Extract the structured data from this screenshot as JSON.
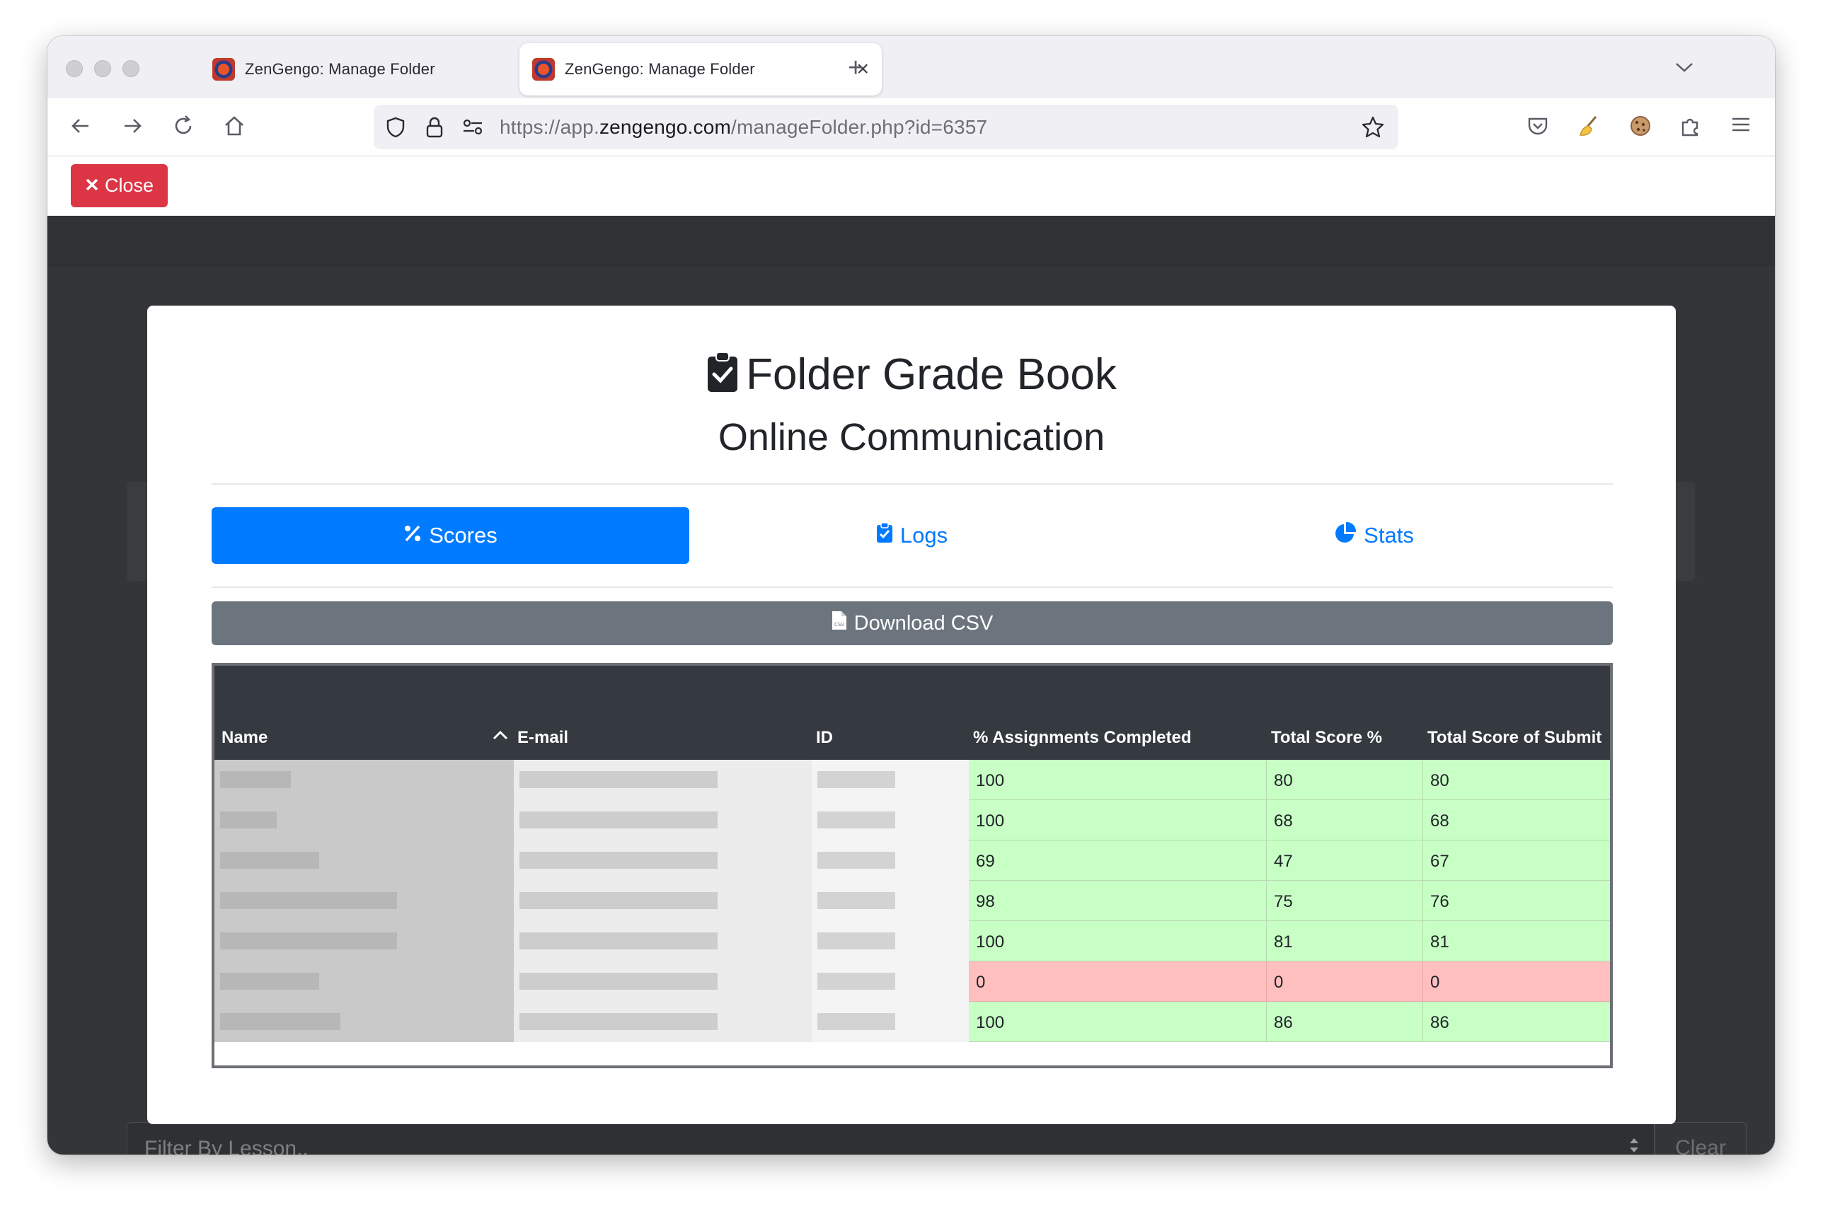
{
  "browser": {
    "tabs": [
      {
        "title": "ZenGengo: Manage Folder",
        "active": false
      },
      {
        "title": "ZenGengo: Manage Folder",
        "active": true
      }
    ],
    "url_prefix": "https://app.",
    "url_host": "zengengo.com",
    "url_path": "/manageFolder.php?id=6357"
  },
  "toolbar": {
    "close_label": "Close"
  },
  "modal": {
    "title": "Folder Grade Book",
    "subtitle": "Online Communication",
    "tabs": [
      {
        "label": "Scores",
        "icon": "percent-icon",
        "active": true
      },
      {
        "label": "Logs",
        "icon": "clipboard-check-icon",
        "active": false
      },
      {
        "label": "Stats",
        "icon": "pie-chart-icon",
        "active": false
      }
    ],
    "download_label": "Download CSV",
    "table": {
      "headers": [
        "Name",
        "E-mail",
        "ID",
        "% Assignments Completed",
        "Total Score %",
        "Total Score of Submit"
      ],
      "rows": [
        {
          "completed": "100",
          "total": "80",
          "submitted": "80",
          "status": "ok"
        },
        {
          "completed": "100",
          "total": "68",
          "submitted": "68",
          "status": "ok"
        },
        {
          "completed": "69",
          "total": "47",
          "submitted": "67",
          "status": "ok"
        },
        {
          "completed": "98",
          "total": "75",
          "submitted": "76",
          "status": "ok"
        },
        {
          "completed": "100",
          "total": "81",
          "submitted": "81",
          "status": "ok"
        },
        {
          "completed": "0",
          "total": "0",
          "submitted": "0",
          "status": "bad"
        },
        {
          "completed": "100",
          "total": "86",
          "submitted": "86",
          "status": "ok"
        }
      ]
    }
  },
  "background": {
    "filter_placeholder": "Filter By Lesson..",
    "clear_label": "Clear"
  },
  "colors": {
    "primary": "#007bff",
    "danger": "#dc3545",
    "secondary": "#6c757d",
    "table_header": "#343a40",
    "row_ok": "#c8ffc4",
    "row_bad": "#ffbfbf"
  }
}
